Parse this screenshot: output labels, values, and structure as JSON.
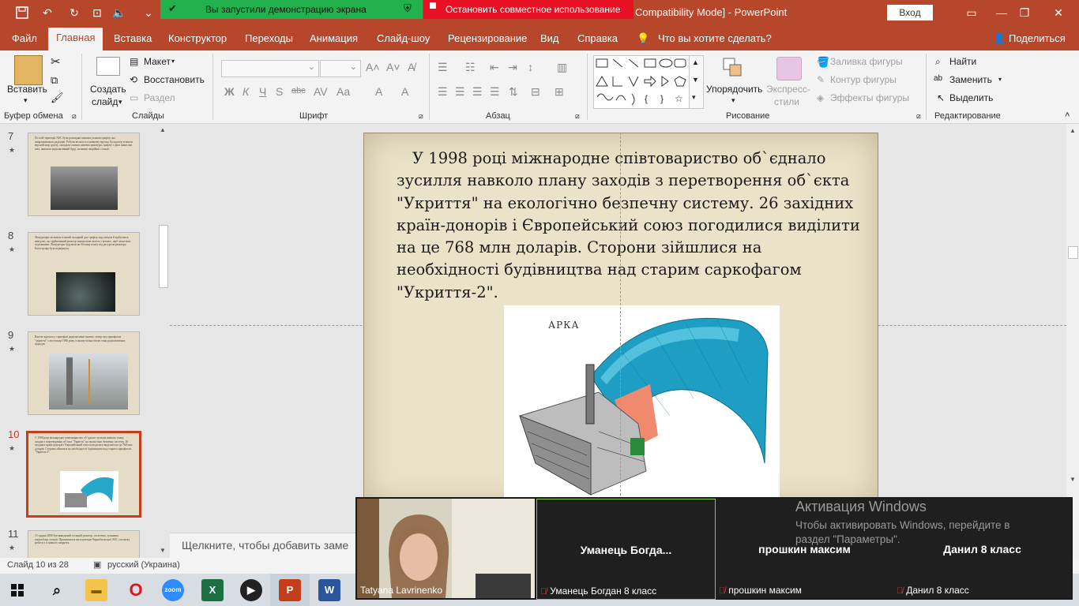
{
  "titlebar": {
    "share_banner": "Вы запустили демонстрацию экрана",
    "stop_share": "Остановить совместное использование",
    "window_title": "Compatibility Mode] - PowerPoint",
    "signin": "Вход"
  },
  "menu": {
    "tabs": [
      "Файл",
      "Главная",
      "Вставка",
      "Конструктор",
      "Переходы",
      "Анимация",
      "Слайд-шоу",
      "Рецензирование",
      "Вид",
      "Справка"
    ],
    "tell_me": "Что вы хотите сделать?",
    "share": "Поделиться"
  },
  "ribbon": {
    "clipboard": {
      "paste": "Вставить",
      "label": "Буфер обмена"
    },
    "slides": {
      "new_slide_line1": "Создать",
      "new_slide_line2": "слайд",
      "layout": "Макет",
      "reset": "Восстановить",
      "section": "Раздел",
      "label": "Слайды"
    },
    "font": {
      "bold": "Ж",
      "italic": "К",
      "underline": "Ч",
      "strike": "S",
      "abc": "abc",
      "label": "Шрифт"
    },
    "paragraph": {
      "label": "Абзац"
    },
    "drawing": {
      "arrange": "Упорядочить",
      "quick_styles_line1": "Экспресс-",
      "quick_styles_line2": "стили",
      "fill": "Заливка фигуры",
      "outline": "Контур фигуры",
      "effects": "Эффекты фигуры",
      "label": "Рисование"
    },
    "editing": {
      "find": "Найти",
      "replace": "Заменить",
      "select": "Выделить",
      "label": "Редактирование"
    }
  },
  "thumbnails": [
    {
      "num": "7",
      "text": "По всій території АЕС були розкидані шматки уламків графіту, які випромінювали радіацію. Роботи велися в основному вручну. Бульдозер зсипали верхній шар ґрунту, складали уламки шматки арматури, графіту з двох навислих шах, знижали радіоактивний бруд, залишки аварійної станції."
    },
    {
      "num": "8",
      "text": "Ліквідатори засипали в інший складний дах графіту, над місцем й відбуллися невідомі, що зруйнований реактор заморозили азотом з кількох, щоб захистити підземними. Ліквідатори будували як бетонну плиту під ресурсом реактора. Катастрофа була відвернута."
    },
    {
      "num": "9",
      "text": "Вже не вдалося у саркофазі радіоактивне паливо, тепер під саркофагом “укриття” з листопада 1986 року, в ньому кілька тисяч тонн радіоактивних відходів."
    },
    {
      "num": "10",
      "text": "У 1998 році міжнародне співтовариство об`єднало зусилля навколо плану заходів з перетворення об`єкта \"Укриття\" на екологічно безпечну систему. 26 західних країн-донорів і Європейський союз погодилися виділити на це 768 млн доларів. Сторони зійшлися на необхідності будівництва над старим саркофагом \"Укриття-2\"."
    },
    {
      "num": "11",
      "text": "15 грудня 2000 був виведений останній реактор, остаточно, зупинено енергоблок станції. Припинилася експлуатація Чорнобильської АЕС з початку роботи з її повного закриття."
    }
  ],
  "slide": {
    "text": "У 1998 році міжнародне співтовариство об`єднало зусилля навколо плану заходів з перетворення об`єкта \"Укриття\" на екологічно безпечну систему. 26 західних країн-донорів і Європейський союз погодилися виділити на це 768 млн доларів. Сторони зійшлися на необхідності будівництва над старим саркофагом \"Укриття-2\".",
    "image_label": "АРКА"
  },
  "notes_placeholder": "Щелкните, чтобы добавить заме",
  "status": {
    "slide_counter": "Слайд 10 из 28",
    "language": "русский (Украина)"
  },
  "video": {
    "self_name": "Tatyana Lavrinenko",
    "tiles": [
      {
        "name": "Уманець  Богда...",
        "full": "Уманець Богдан 8 класс"
      },
      {
        "name": "прошкин максим",
        "full": "прошкин максим"
      },
      {
        "name": "Данил 8 класс",
        "full": "Данил 8 класс"
      }
    ]
  },
  "activation": {
    "title": "Активация Windows",
    "line1": "Чтобы активировать Windows, перейдите в",
    "line2": "раздел \"Параметры\"."
  },
  "colors": {
    "brand": "#b7472a",
    "share_green": "#22b14c",
    "stop_red": "#e81123",
    "selected_thumb": "#c43e1c"
  }
}
